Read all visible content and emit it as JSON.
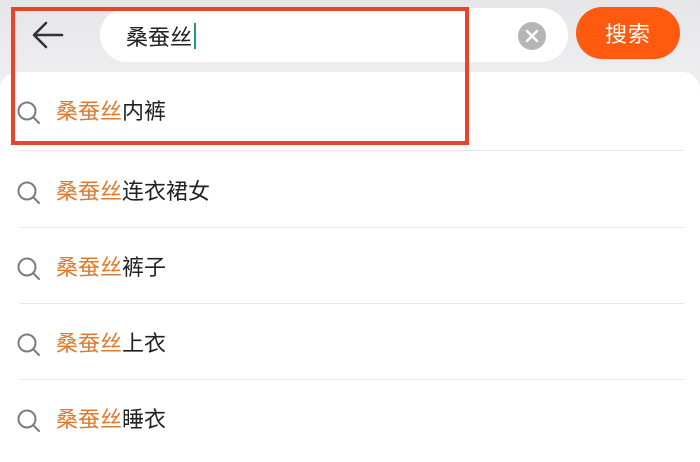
{
  "header": {
    "back_icon": "arrow-left-icon",
    "search_value": "桑蚕丝",
    "clear_icon": "clear-icon",
    "search_button_label": "搜索"
  },
  "suggestions": [
    {
      "keyword": "桑蚕丝",
      "rest": "内裤"
    },
    {
      "keyword": "桑蚕丝",
      "rest": "连衣裙女"
    },
    {
      "keyword": "桑蚕丝",
      "rest": "裤子"
    },
    {
      "keyword": "桑蚕丝",
      "rest": "上衣"
    },
    {
      "keyword": "桑蚕丝",
      "rest": "睡衣"
    }
  ],
  "colors": {
    "accent": "#ff5a0f",
    "keyword": "#e07a2c",
    "annotation_box": "#e8432b"
  }
}
